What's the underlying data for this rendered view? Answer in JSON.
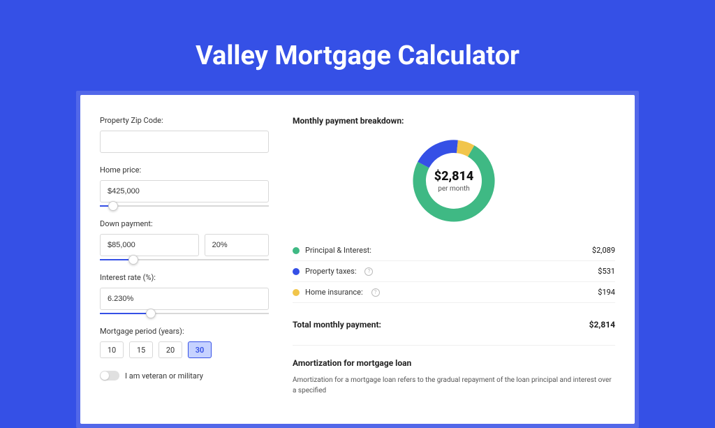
{
  "page": {
    "title": "Valley Mortgage Calculator"
  },
  "form": {
    "zip": {
      "label": "Property Zip Code:",
      "value": ""
    },
    "home_price": {
      "label": "Home price:",
      "value": "$425,000",
      "slider_pct": 8
    },
    "down_payment": {
      "label": "Down payment:",
      "amount": "$85,000",
      "pct": "20%",
      "slider_pct": 20
    },
    "interest": {
      "label": "Interest rate (%):",
      "value": "6.230%",
      "slider_pct": 30
    },
    "period": {
      "label": "Mortgage period (years):",
      "options": [
        "10",
        "15",
        "20",
        "30"
      ],
      "selected": "30"
    },
    "veteran": {
      "label": "I am veteran or military",
      "checked": false
    }
  },
  "breakdown": {
    "title": "Monthly payment breakdown:",
    "center_amount": "$2,814",
    "center_sub": "per month",
    "items": [
      {
        "label": "Principal & Interest:",
        "value": "$2,089",
        "color": "#3fb984",
        "has_info": false
      },
      {
        "label": "Property taxes:",
        "value": "$531",
        "color": "#3550e6",
        "has_info": true
      },
      {
        "label": "Home insurance:",
        "value": "$194",
        "color": "#f1c54b",
        "has_info": true
      }
    ],
    "total": {
      "label": "Total monthly payment:",
      "value": "$2,814"
    }
  },
  "chart_data": {
    "type": "pie",
    "title": "Monthly payment breakdown",
    "series": [
      {
        "name": "Principal & Interest",
        "value": 2089,
        "color": "#3fb984"
      },
      {
        "name": "Property taxes",
        "value": 531,
        "color": "#3550e6"
      },
      {
        "name": "Home insurance",
        "value": 194,
        "color": "#f1c54b"
      }
    ],
    "total": 2814,
    "center_label": "$2,814 per month"
  },
  "amortization": {
    "title": "Amortization for mortgage loan",
    "text": "Amortization for a mortgage loan refers to the gradual repayment of the loan principal and interest over a specified"
  }
}
